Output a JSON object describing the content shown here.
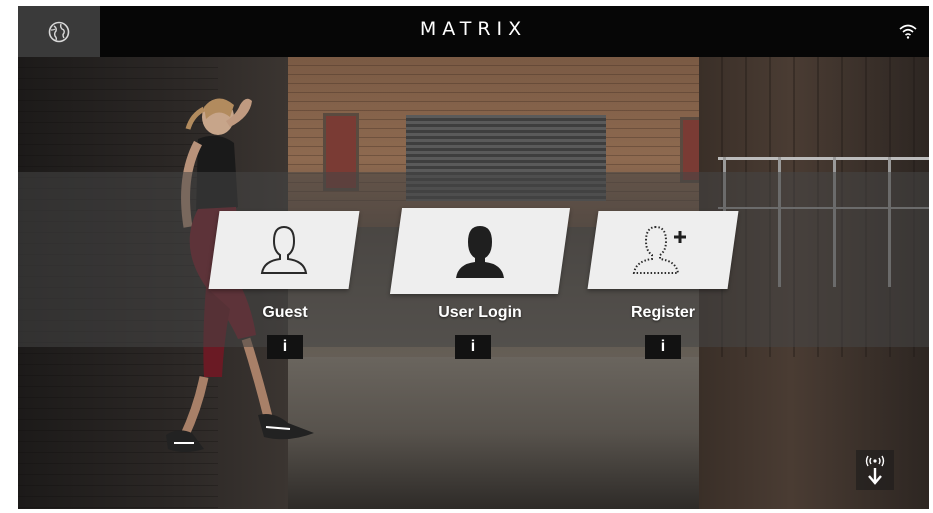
{
  "header": {
    "brand": "MATRIX",
    "globe_icon": "globe-icon",
    "wifi_icon": "wifi-icon"
  },
  "login_options": [
    {
      "label": "Guest",
      "icon": "user-outline-icon",
      "info": "i"
    },
    {
      "label": "User Login",
      "icon": "user-filled-icon",
      "info": "i"
    },
    {
      "label": "Register",
      "icon": "add-user-icon",
      "info": "i"
    }
  ],
  "footer": {
    "download_icon": "wireless-download-icon"
  },
  "colors": {
    "topbar": "#060606",
    "globe_button": "#3a3a3a",
    "tile": "#eeeeee",
    "info_button": "#121212",
    "text": "#ffffff"
  }
}
